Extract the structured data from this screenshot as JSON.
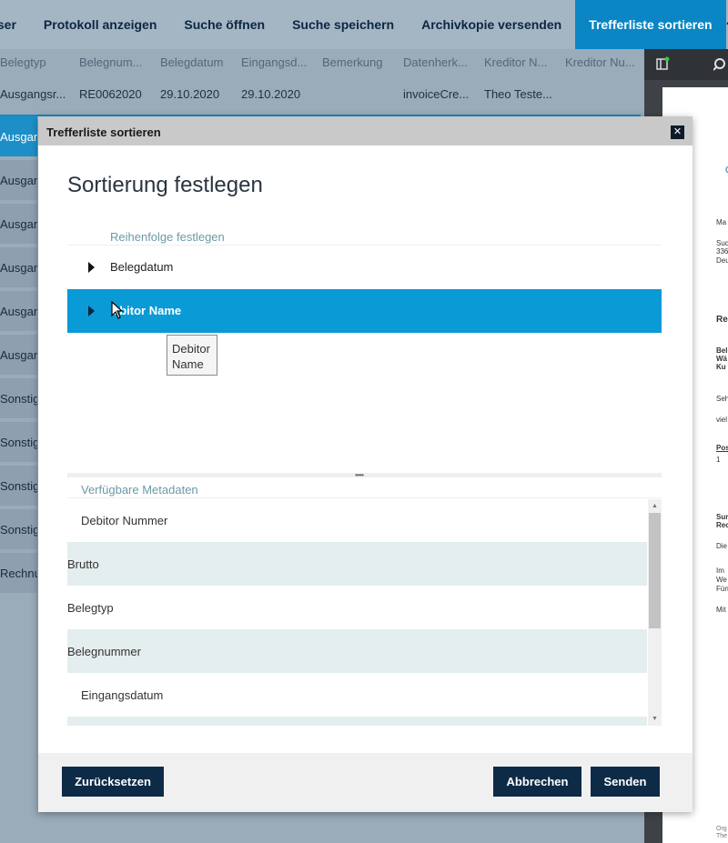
{
  "toolbar": {
    "items": [
      "wser",
      "Protokoll anzeigen",
      "Suche öffnen",
      "Suche speichern",
      "Archivkopie versenden",
      "Trefferliste sortieren"
    ],
    "more": "···"
  },
  "grid": {
    "headers": [
      "Belegtyp",
      "Belegnum...",
      "Belegdatum",
      "Eingangsd...",
      "Bemerkung",
      "Datenherk...",
      "Kreditor N...",
      "Kreditor Nu..."
    ],
    "row1": [
      "Ausgangsr...",
      "RE0062020",
      "29.10.2020",
      "29.10.2020",
      "",
      "invoiceCre...",
      "Theo Teste...",
      ""
    ],
    "side_items": [
      "Ausgan",
      "Ausgan",
      "Ausgan",
      "Ausgan",
      "Ausgan",
      "Ausgan",
      "Sonstig",
      "Sonstig",
      "Sonstig",
      "Sonstig",
      "Rechnu"
    ]
  },
  "right_panel": {
    "snippets": [
      "C",
      "Ma",
      "Suc",
      "336",
      "Deu",
      "Re",
      "Bel",
      "Wä",
      "Ku",
      "Seh",
      "viel",
      "Pos",
      "1",
      "Sur",
      "Rec",
      "Die",
      "Im",
      "We",
      "Fün",
      "Mit",
      "Org",
      "The"
    ]
  },
  "modal": {
    "window_title": "Trefferliste sortieren",
    "close": "✕",
    "heading": "Sortierung festlegen",
    "order_label": "Reihenfolge festlegen",
    "order_items": [
      "Belegdatum",
      "ebitor Name"
    ],
    "tooltip_line1": "Debitor",
    "tooltip_line2": "Name",
    "splitter_grip": "•••••",
    "available_label": "Verfügbare Metadaten",
    "available_items": [
      "Debitor Nummer",
      "Brutto",
      "Belegtyp",
      "Belegnummer",
      "Eingangsdatum"
    ],
    "buttons": {
      "reset": "Zurücksetzen",
      "cancel": "Abbrechen",
      "send": "Senden"
    }
  },
  "colors": {
    "accent": "#0a9ad6",
    "toolbar_active": "#0a86c4",
    "button": "#0d2a47"
  }
}
